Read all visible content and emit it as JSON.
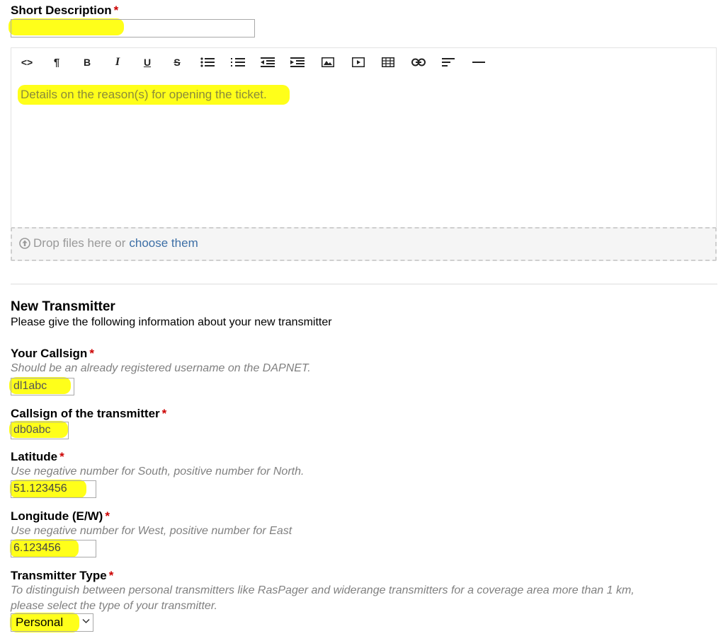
{
  "short_description": {
    "label": "Short Description",
    "required_mark": "*",
    "value": ""
  },
  "editor": {
    "toolbar_icons": [
      "code-icon",
      "paragraph-icon",
      "bold-icon",
      "italic-icon",
      "underline-icon",
      "strikethrough-icon",
      "bullet-list-icon",
      "numbered-list-icon",
      "outdent-icon",
      "indent-icon",
      "image-icon",
      "video-icon",
      "table-icon",
      "link-icon",
      "align-icon",
      "horizontal-rule-icon"
    ],
    "toolbar_text": {
      "code": "<>",
      "paragraph": "¶",
      "bold": "B",
      "italic": "I",
      "underline": "U",
      "strike": "S"
    },
    "placeholder": "Details on the reason(s) for opening the ticket.",
    "dropzone_text": "Drop files here or",
    "dropzone_link": "choose them"
  },
  "new_transmitter": {
    "title": "New Transmitter",
    "subtitle": "Please give the following information about your new transmitter"
  },
  "fields": {
    "your_callsign": {
      "label": "Your Callsign",
      "required_mark": "*",
      "hint": "Should be an already registered username on the DAPNET.",
      "value": "dl1abc"
    },
    "transmitter_callsign": {
      "label": "Callsign of the transmitter",
      "required_mark": "*",
      "value": "db0abc"
    },
    "latitude": {
      "label": "Latitude",
      "required_mark": "*",
      "hint": "Use negative number for South, positive number for North.",
      "value": "51.123456"
    },
    "longitude": {
      "label": "Longitude (E/W)",
      "required_mark": "*",
      "hint": "Use negative number for West, positive number for East",
      "value": "6.123456"
    },
    "transmitter_type": {
      "label": "Transmitter Type",
      "required_mark": "*",
      "hint_line1": "To distinguish between personal transmitters like RasPager and widerange transmitters for a coverage area more than 1 km,",
      "hint_line2": "please select the type of your transmitter.",
      "selected": "Personal"
    }
  },
  "colors": {
    "highlight": "#ffff1a",
    "required": "#cc0000",
    "hint": "#808080",
    "link": "#3d6fa6"
  }
}
